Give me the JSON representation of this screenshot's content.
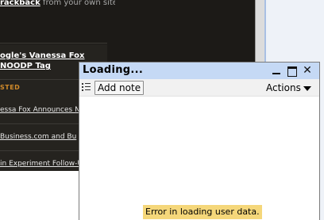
{
  "background_page": {
    "trackback_line": {
      "bold": "rackback",
      "rest": " from your own site."
    },
    "featured_post": {
      "line1": "ogle's Vanessa Fox",
      "line2": "NOODP Tag"
    },
    "section_label": "STED",
    "recent_posts": [
      "essa Fox Announces NOO",
      "Business.com and Bu",
      "in Experiment Follow-U"
    ]
  },
  "widget": {
    "title": "Loading...",
    "window_controls": [
      "minimize",
      "maximize",
      "close"
    ],
    "close_glyph": "✕",
    "toolbar": {
      "add_note_label": "Add note",
      "actions_label": "Actions"
    },
    "error_message": "Error in loading user data."
  },
  "colors": {
    "titlebar": "#c5d9f5",
    "error_highlight": "#f5d77a",
    "page_dark": "#1c1a17",
    "accent_orange": "#d08a2a"
  },
  "icons": [
    "list-icon",
    "minimize-icon",
    "maximize-icon",
    "close-icon",
    "caret-down-icon"
  ]
}
